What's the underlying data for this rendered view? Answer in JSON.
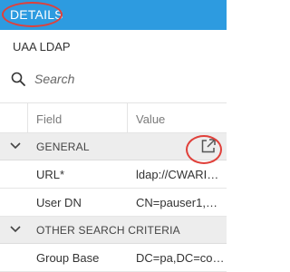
{
  "header": {
    "title": "DETAILS"
  },
  "subtitle": "UAA LDAP",
  "search": {
    "placeholder": "Search"
  },
  "table": {
    "columns": {
      "field": "Field",
      "value": "Value"
    },
    "groups": [
      {
        "label": "GENERAL",
        "rows": [
          {
            "field": "URL*",
            "value": "ldap://CWARI…"
          },
          {
            "field": "User DN",
            "value": "CN=pauser1,…"
          }
        ]
      },
      {
        "label": "OTHER SEARCH CRITERIA",
        "rows": [
          {
            "field": "Group Base",
            "value": "DC=pa,DC=co…"
          }
        ]
      }
    ]
  },
  "colors": {
    "header_bg": "#2d9be0",
    "highlight_ring": "#e0403a",
    "group_bg": "#ededed"
  },
  "icons": {
    "search": "search-icon",
    "chevron": "chevron-down-icon",
    "external": "open-external-icon"
  }
}
